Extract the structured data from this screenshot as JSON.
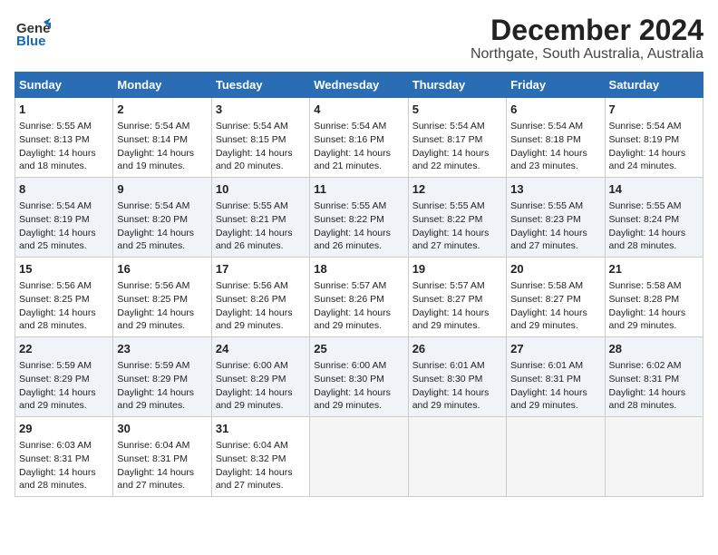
{
  "logo": {
    "line1": "General",
    "line2": "Blue"
  },
  "title": "December 2024",
  "subtitle": "Northgate, South Australia, Australia",
  "days_of_week": [
    "Sunday",
    "Monday",
    "Tuesday",
    "Wednesday",
    "Thursday",
    "Friday",
    "Saturday"
  ],
  "weeks": [
    [
      {
        "day": "1",
        "sunrise": "5:55 AM",
        "sunset": "8:13 PM",
        "daylight": "14 hours and 18 minutes."
      },
      {
        "day": "2",
        "sunrise": "5:54 AM",
        "sunset": "8:14 PM",
        "daylight": "14 hours and 19 minutes."
      },
      {
        "day": "3",
        "sunrise": "5:54 AM",
        "sunset": "8:15 PM",
        "daylight": "14 hours and 20 minutes."
      },
      {
        "day": "4",
        "sunrise": "5:54 AM",
        "sunset": "8:16 PM",
        "daylight": "14 hours and 21 minutes."
      },
      {
        "day": "5",
        "sunrise": "5:54 AM",
        "sunset": "8:17 PM",
        "daylight": "14 hours and 22 minutes."
      },
      {
        "day": "6",
        "sunrise": "5:54 AM",
        "sunset": "8:18 PM",
        "daylight": "14 hours and 23 minutes."
      },
      {
        "day": "7",
        "sunrise": "5:54 AM",
        "sunset": "8:19 PM",
        "daylight": "14 hours and 24 minutes."
      }
    ],
    [
      {
        "day": "8",
        "sunrise": "5:54 AM",
        "sunset": "8:19 PM",
        "daylight": "14 hours and 25 minutes."
      },
      {
        "day": "9",
        "sunrise": "5:54 AM",
        "sunset": "8:20 PM",
        "daylight": "14 hours and 25 minutes."
      },
      {
        "day": "10",
        "sunrise": "5:55 AM",
        "sunset": "8:21 PM",
        "daylight": "14 hours and 26 minutes."
      },
      {
        "day": "11",
        "sunrise": "5:55 AM",
        "sunset": "8:22 PM",
        "daylight": "14 hours and 26 minutes."
      },
      {
        "day": "12",
        "sunrise": "5:55 AM",
        "sunset": "8:22 PM",
        "daylight": "14 hours and 27 minutes."
      },
      {
        "day": "13",
        "sunrise": "5:55 AM",
        "sunset": "8:23 PM",
        "daylight": "14 hours and 27 minutes."
      },
      {
        "day": "14",
        "sunrise": "5:55 AM",
        "sunset": "8:24 PM",
        "daylight": "14 hours and 28 minutes."
      }
    ],
    [
      {
        "day": "15",
        "sunrise": "5:56 AM",
        "sunset": "8:25 PM",
        "daylight": "14 hours and 28 minutes."
      },
      {
        "day": "16",
        "sunrise": "5:56 AM",
        "sunset": "8:25 PM",
        "daylight": "14 hours and 29 minutes."
      },
      {
        "day": "17",
        "sunrise": "5:56 AM",
        "sunset": "8:26 PM",
        "daylight": "14 hours and 29 minutes."
      },
      {
        "day": "18",
        "sunrise": "5:57 AM",
        "sunset": "8:26 PM",
        "daylight": "14 hours and 29 minutes."
      },
      {
        "day": "19",
        "sunrise": "5:57 AM",
        "sunset": "8:27 PM",
        "daylight": "14 hours and 29 minutes."
      },
      {
        "day": "20",
        "sunrise": "5:58 AM",
        "sunset": "8:27 PM",
        "daylight": "14 hours and 29 minutes."
      },
      {
        "day": "21",
        "sunrise": "5:58 AM",
        "sunset": "8:28 PM",
        "daylight": "14 hours and 29 minutes."
      }
    ],
    [
      {
        "day": "22",
        "sunrise": "5:59 AM",
        "sunset": "8:29 PM",
        "daylight": "14 hours and 29 minutes."
      },
      {
        "day": "23",
        "sunrise": "5:59 AM",
        "sunset": "8:29 PM",
        "daylight": "14 hours and 29 minutes."
      },
      {
        "day": "24",
        "sunrise": "6:00 AM",
        "sunset": "8:29 PM",
        "daylight": "14 hours and 29 minutes."
      },
      {
        "day": "25",
        "sunrise": "6:00 AM",
        "sunset": "8:30 PM",
        "daylight": "14 hours and 29 minutes."
      },
      {
        "day": "26",
        "sunrise": "6:01 AM",
        "sunset": "8:30 PM",
        "daylight": "14 hours and 29 minutes."
      },
      {
        "day": "27",
        "sunrise": "6:01 AM",
        "sunset": "8:31 PM",
        "daylight": "14 hours and 29 minutes."
      },
      {
        "day": "28",
        "sunrise": "6:02 AM",
        "sunset": "8:31 PM",
        "daylight": "14 hours and 28 minutes."
      }
    ],
    [
      {
        "day": "29",
        "sunrise": "6:03 AM",
        "sunset": "8:31 PM",
        "daylight": "14 hours and 28 minutes."
      },
      {
        "day": "30",
        "sunrise": "6:04 AM",
        "sunset": "8:31 PM",
        "daylight": "14 hours and 27 minutes."
      },
      {
        "day": "31",
        "sunrise": "6:04 AM",
        "sunset": "8:32 PM",
        "daylight": "14 hours and 27 minutes."
      },
      null,
      null,
      null,
      null
    ]
  ],
  "labels": {
    "sunrise": "Sunrise:",
    "sunset": "Sunset:",
    "daylight": "Daylight:"
  }
}
